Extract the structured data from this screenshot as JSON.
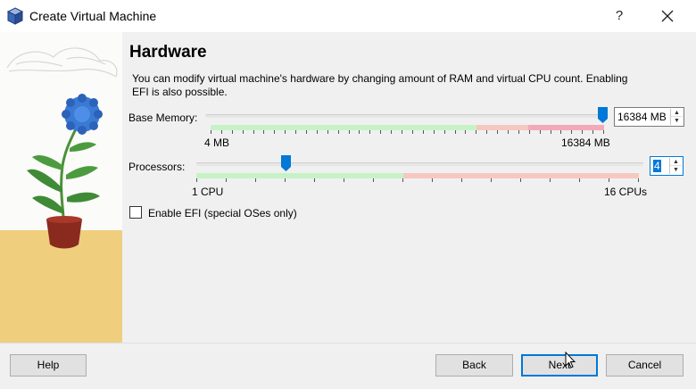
{
  "window": {
    "title": "Create Virtual Machine",
    "help_label": "?",
    "close_label": "✕"
  },
  "page": {
    "heading": "Hardware",
    "description": "You can modify virtual machine's hardware by changing amount of RAM and virtual CPU count. Enabling EFI is also possible."
  },
  "memory": {
    "label": "Base Memory:",
    "value": "16384 MB",
    "min_label": "4 MB",
    "max_label": "16384 MB",
    "slider_fraction": 1.0
  },
  "processors": {
    "label": "Processors:",
    "value": "4",
    "min_label": "1 CPU",
    "max_label": "16 CPUs",
    "slider_fraction": 0.2
  },
  "efi": {
    "label": "Enable EFI (special OSes only)",
    "checked": false
  },
  "footer": {
    "help": "Help",
    "back": "Back",
    "next": "Next",
    "cancel": "Cancel"
  },
  "colors": {
    "accent": "#0078d7",
    "scale_green": "#c6f3c6",
    "scale_red": "#f6c8c1",
    "scale_pink": "#f3a9b7",
    "footer_bg": "#f0f0f0"
  },
  "icons": {
    "app": "virtualbox-cube-icon",
    "close": "close-icon",
    "spin": "spin-arrows-icon"
  }
}
